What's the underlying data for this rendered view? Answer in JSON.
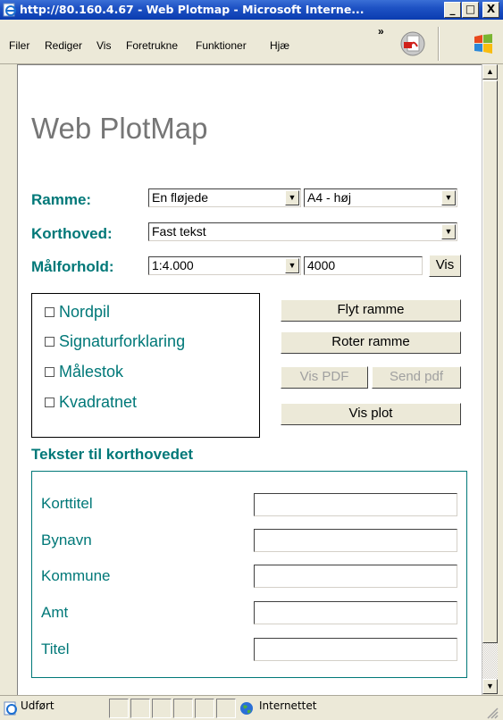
{
  "window": {
    "title": "http://80.160.4.67 - Web Plotmap - Microsoft Interne...",
    "min_label": "_",
    "max_label": "□",
    "close_label": "X"
  },
  "menu": {
    "items": [
      "Filer",
      "Rediger",
      "Vis",
      "Foretrukne",
      "Funktioner",
      "Hjæ"
    ],
    "chevron": "»"
  },
  "page": {
    "title": "Web PlotMap",
    "ramme_label": "Ramme:",
    "ramme_value": "En fløjede",
    "papir_value": "A4 - høj",
    "korthoved_label": "Korthoved:",
    "korthoved_value": "Fast tekst",
    "maalforhold_label": "Målforhold:",
    "maalforhold_value": "1:4.000",
    "scale_input_value": "4000",
    "vis_button": "Vis",
    "checkboxes": [
      "Nordpil",
      "Signaturforklaring",
      "Målestok",
      "Kvadratnet"
    ],
    "buttons": {
      "flyt": "Flyt ramme",
      "roter": "Roter ramme",
      "vis_pdf": "Vis PDF",
      "send_pdf": "Send pdf",
      "vis_plot": "Vis plot"
    },
    "section_title": "Tekster til korthovedet",
    "fields": [
      "Korttitel",
      "Bynavn",
      "Kommune",
      "Amt",
      "Titel"
    ]
  },
  "status": {
    "left_text": "Udført",
    "zone_text": "Internettet"
  },
  "colors": {
    "accent": "#007878",
    "title_gray": "#767676",
    "titlebar_blue": "#0a3cb0"
  }
}
